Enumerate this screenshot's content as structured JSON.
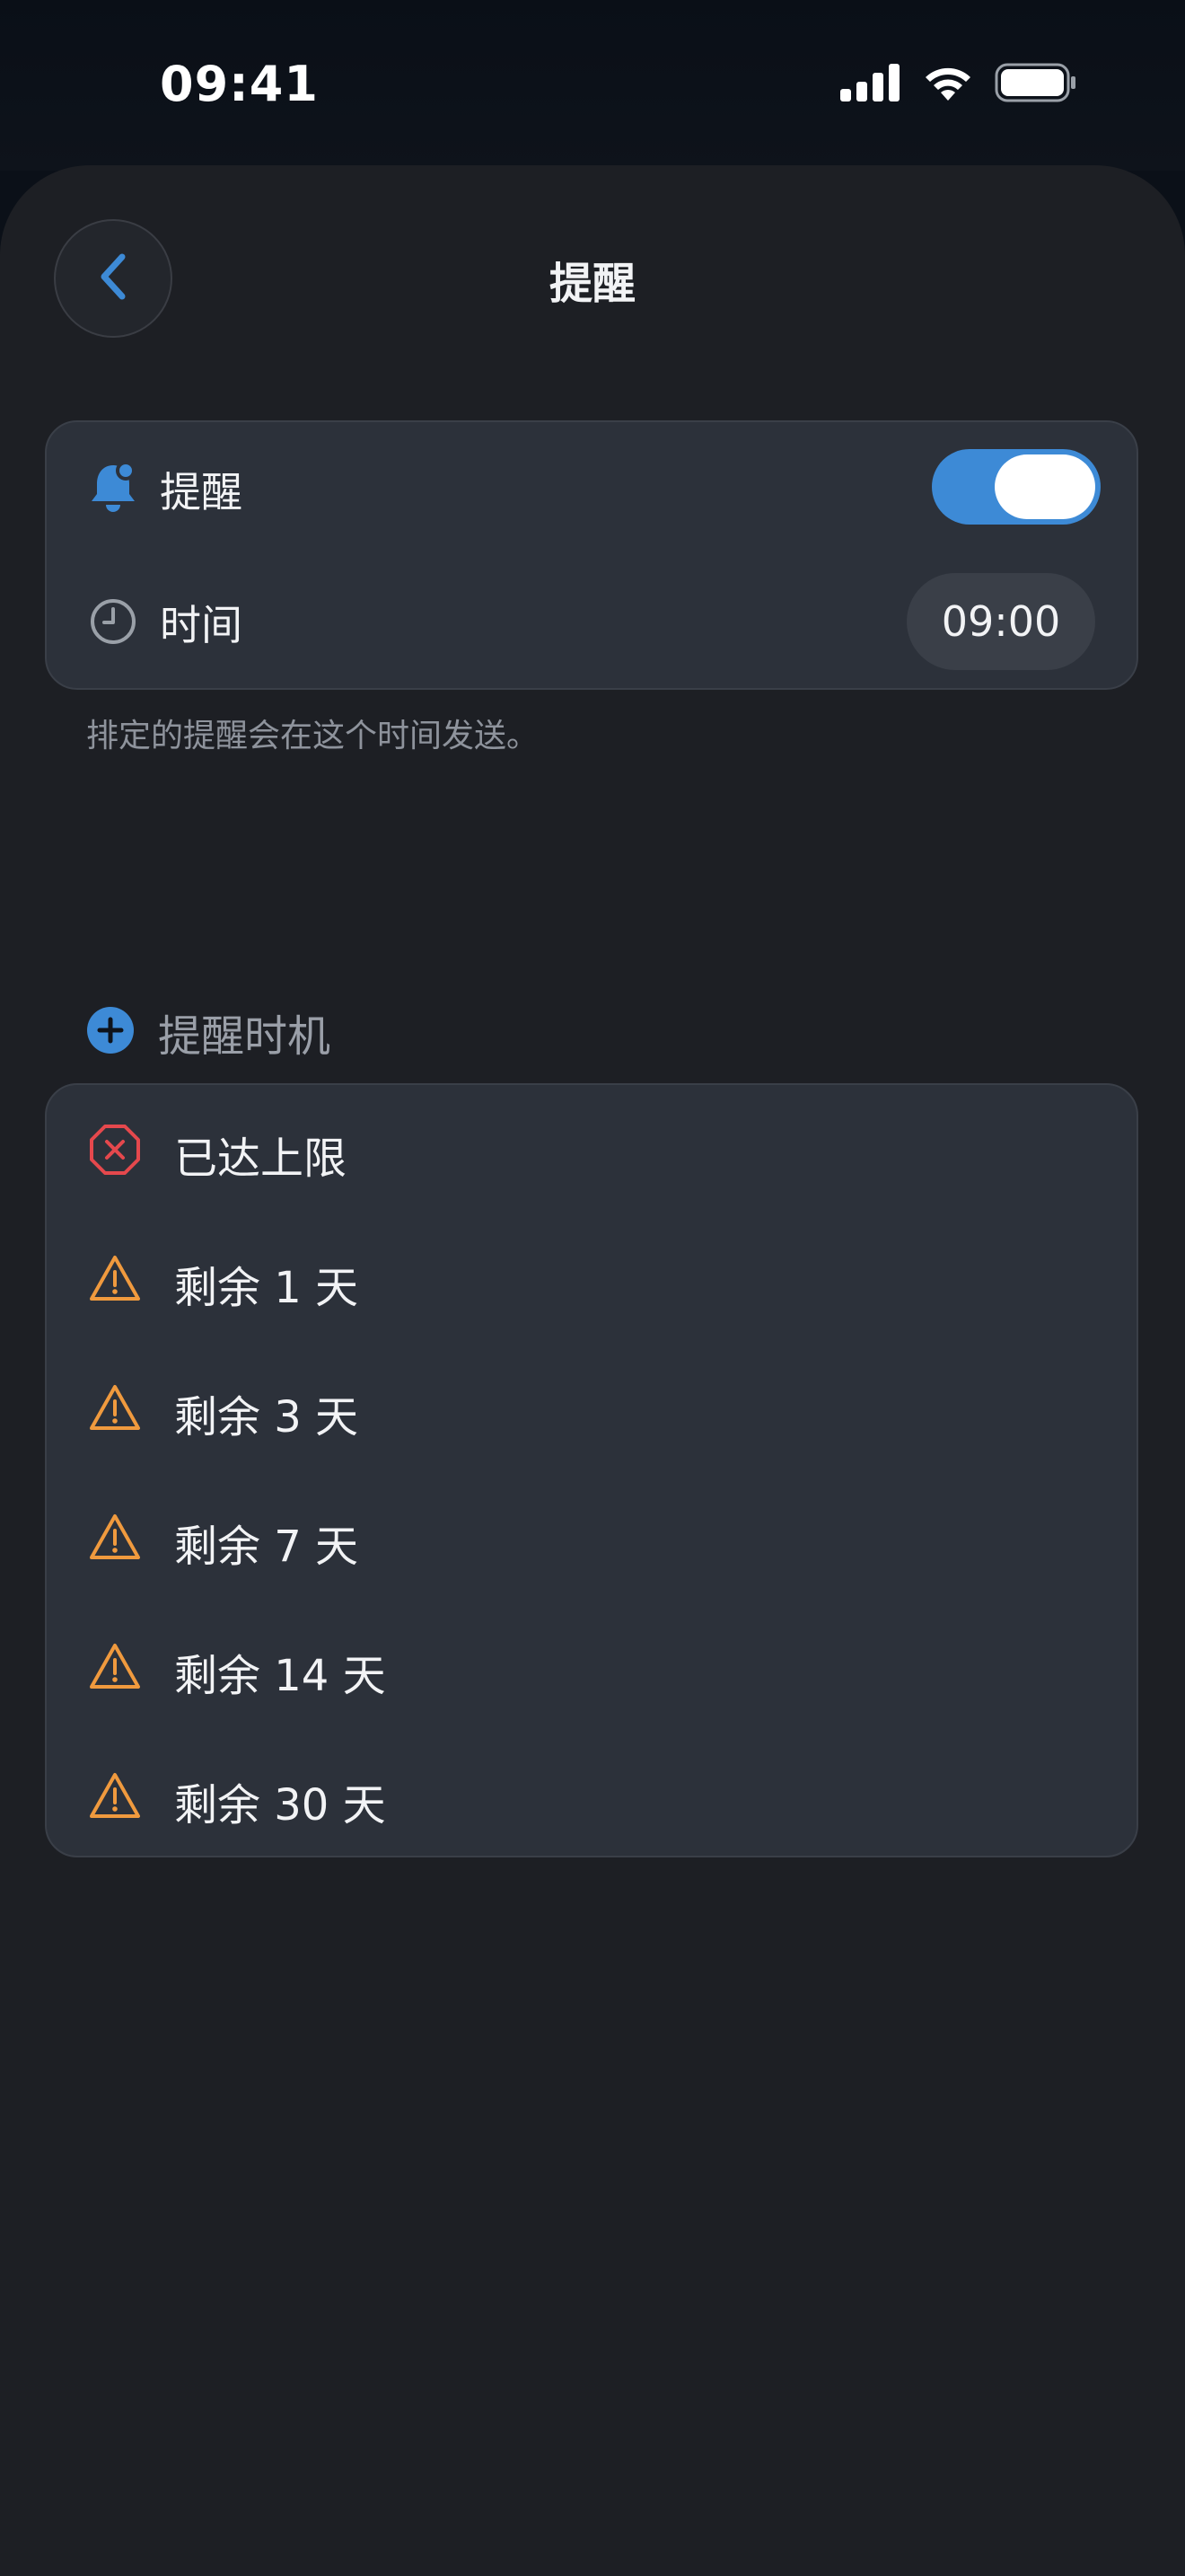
{
  "status_bar": {
    "time": "09:41"
  },
  "header": {
    "title": "提醒"
  },
  "settings": {
    "reminder_label": "提醒",
    "reminder_enabled": true,
    "time_label": "时间",
    "time_value": "09:00",
    "hint": "排定的提醒会在这个时间发送。"
  },
  "triggers": {
    "section_label": "提醒时机",
    "items": [
      {
        "label": "已达上限",
        "icon": "error-x-icon"
      },
      {
        "label": "剩余 1 天",
        "icon": "warning-icon"
      },
      {
        "label": "剩余 3 天",
        "icon": "warning-icon"
      },
      {
        "label": "剩余 7 天",
        "icon": "warning-icon"
      },
      {
        "label": "剩余 14 天",
        "icon": "warning-icon"
      },
      {
        "label": "剩余 30 天",
        "icon": "warning-icon"
      }
    ]
  },
  "colors": {
    "accent": "#3d8ad6",
    "warning": "#f09a3e",
    "error": "#e5484d",
    "background": "#1d1f24",
    "card": "#2c313a"
  }
}
